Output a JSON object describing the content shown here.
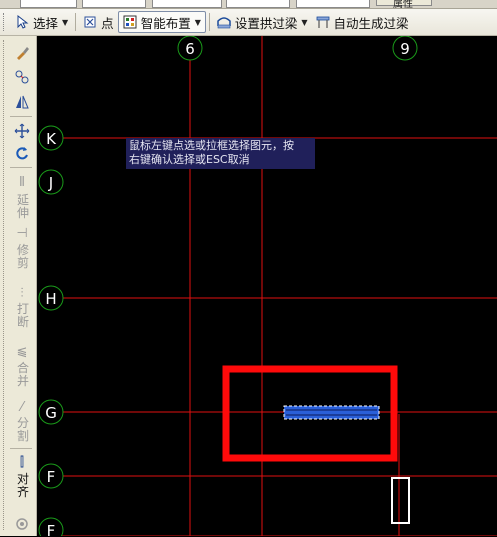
{
  "top_strip": {
    "partial_button_label": "属性"
  },
  "toolbar": {
    "select_label": "选择",
    "point_label": "点",
    "smart_layout_label": "智能布置",
    "set_arch_beam_label": "设置拱过梁",
    "auto_lintel_label": "自动生成过梁"
  },
  "sidebar": {
    "extend": [
      "延",
      "伸"
    ],
    "trim": [
      "修",
      "剪"
    ],
    "break": [
      "打",
      "断"
    ],
    "merge": [
      "合",
      "并"
    ],
    "split": [
      "分",
      "割"
    ],
    "align": [
      "对",
      "齐"
    ]
  },
  "grid_axes": {
    "vertical": [
      "6",
      "9"
    ],
    "horizontal": [
      "K",
      "J",
      "H",
      "G",
      "F",
      "F"
    ]
  },
  "tooltip": {
    "line1": "鼠标左键点选或拉框选择图元，按",
    "line2": "右键确认选择或ESC取消"
  },
  "colors": {
    "canvas_bg": "#000000",
    "axis_line": "#e01010",
    "axis_bubble": "#1a9a1a",
    "highlight_box": "#ff0a0a",
    "selected_element": "#2a5fd8",
    "tooltip_bg": "#20205a"
  }
}
